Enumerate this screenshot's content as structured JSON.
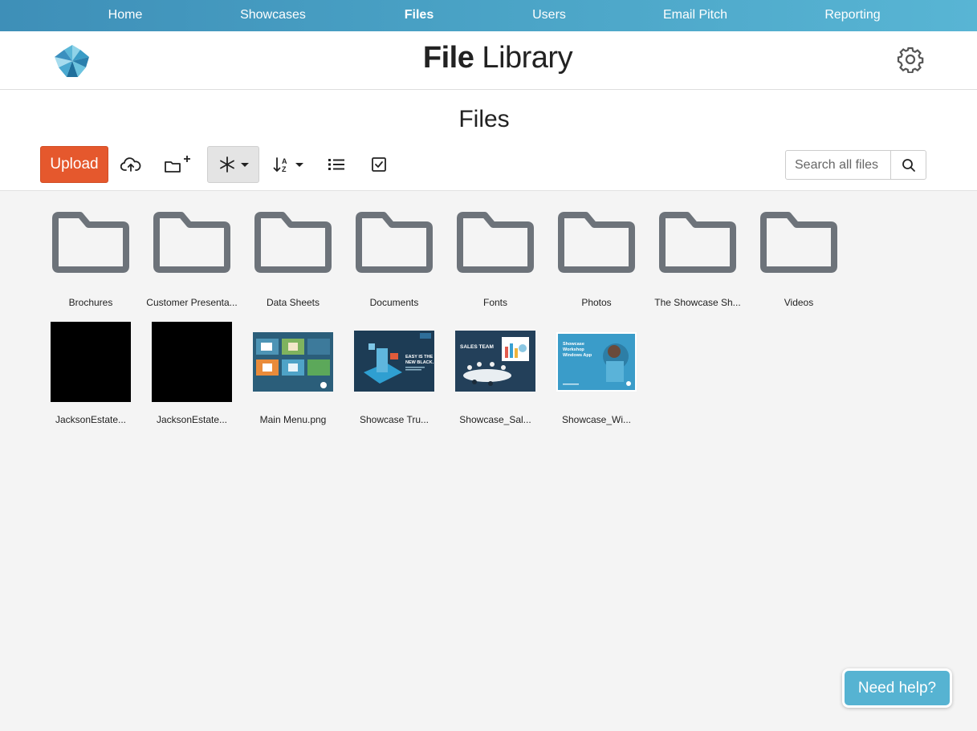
{
  "nav": {
    "items": [
      {
        "label": "Home"
      },
      {
        "label": "Showcases"
      },
      {
        "label": "Files",
        "active": true
      },
      {
        "label": "Users"
      },
      {
        "label": "Email Pitch"
      },
      {
        "label": "Reporting"
      }
    ]
  },
  "header": {
    "title_bold": "File",
    "title_rest": " Library",
    "settings_icon": "gear-icon"
  },
  "files": {
    "title": "Files",
    "toolbar": {
      "upload_label": "Upload",
      "icons": [
        "cloud-upload-icon",
        "new-folder-icon",
        "filter-asterisk-icon",
        "sort-az-icon",
        "list-view-icon",
        "select-checkbox-icon"
      ]
    },
    "search": {
      "placeholder": "Search all files",
      "value": ""
    },
    "folders": [
      {
        "name": "Brochures"
      },
      {
        "name": "Customer Presenta..."
      },
      {
        "name": "Data Sheets"
      },
      {
        "name": "Documents"
      },
      {
        "name": "Fonts"
      },
      {
        "name": "Photos"
      },
      {
        "name": "The Showcase Sh..."
      },
      {
        "name": "Videos"
      }
    ],
    "items": [
      {
        "name": "JacksonEstate..."
      },
      {
        "name": "JacksonEstate..."
      },
      {
        "name": "Main Menu.png"
      },
      {
        "name": "Showcase Tru...",
        "thumb_text": [
          "EASY IS THE",
          "NEW BLACK."
        ]
      },
      {
        "name": "Showcase_Sal...",
        "thumb_text": [
          "SALES TEAM"
        ]
      },
      {
        "name": "Showcase_Wi...",
        "thumb_text": [
          "Showcase",
          "Workshop",
          "Windows App"
        ]
      }
    ]
  },
  "help": {
    "label": "Need help?"
  },
  "colors": {
    "accent": "#4aa3c6",
    "upload": "#e5582d",
    "folder": "#6d737a"
  }
}
